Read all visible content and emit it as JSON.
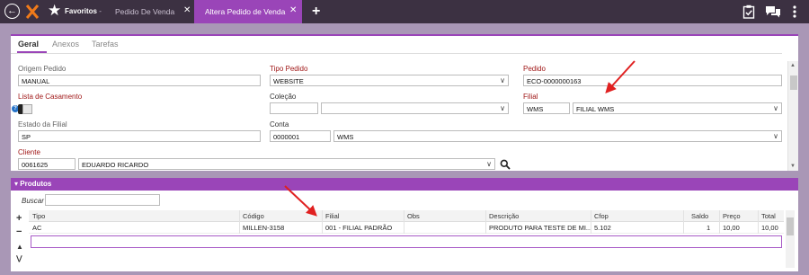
{
  "topbar": {
    "back_icon": "back-circle-icon",
    "favorites_label": "Favoritos",
    "favorites_suffix": "-",
    "tabs": [
      {
        "label": "Pedido De Venda",
        "close": "✕"
      },
      {
        "label": "Altera Pedido de Venda",
        "close": "✕"
      }
    ],
    "add_tab": "+",
    "accent": "#9a45b8",
    "bar_color": "#3c3142"
  },
  "form": {
    "tabs": [
      "Geral",
      "Anexos",
      "Tarefas"
    ],
    "origem_label": "Origem Pedido",
    "origem_value": "MANUAL",
    "tipo_label": "Tipo Pedido",
    "tipo_value": "WEBSITE",
    "pedido_label": "Pedido",
    "pedido_value": "ECO-0000000163",
    "lista_label": "Lista de Casamento",
    "colecao_label": "Coleção",
    "filial_label": "Filial",
    "filial_code": "WMS",
    "filial_name": "FILIAL WMS",
    "estado_label": "Estado da Filial",
    "estado_value": "SP",
    "conta_label": "Conta",
    "conta_code": "0000001",
    "conta_name": "WMS",
    "cliente_label": "Cliente",
    "cliente_code": "0061625",
    "cliente_name": "EDUARDO RICARDO"
  },
  "produtos": {
    "section_label": "Produtos",
    "buscar_label": "Buscar",
    "columns": [
      "Tipo",
      "Código",
      "Filial",
      "Obs",
      "Descrição",
      "Cfop",
      "Saldo",
      "Preço",
      "Total"
    ],
    "rows": [
      [
        "AC",
        "MILLEN-3158",
        "001 - FILIAL PADRÃO",
        "",
        "PRODUTO PARA TESTE DE MI...",
        "5.102",
        "1",
        "10,00",
        "10,00"
      ]
    ]
  },
  "colors": {
    "required_label": "#a01818",
    "annotation_arrow": "#e02020"
  }
}
